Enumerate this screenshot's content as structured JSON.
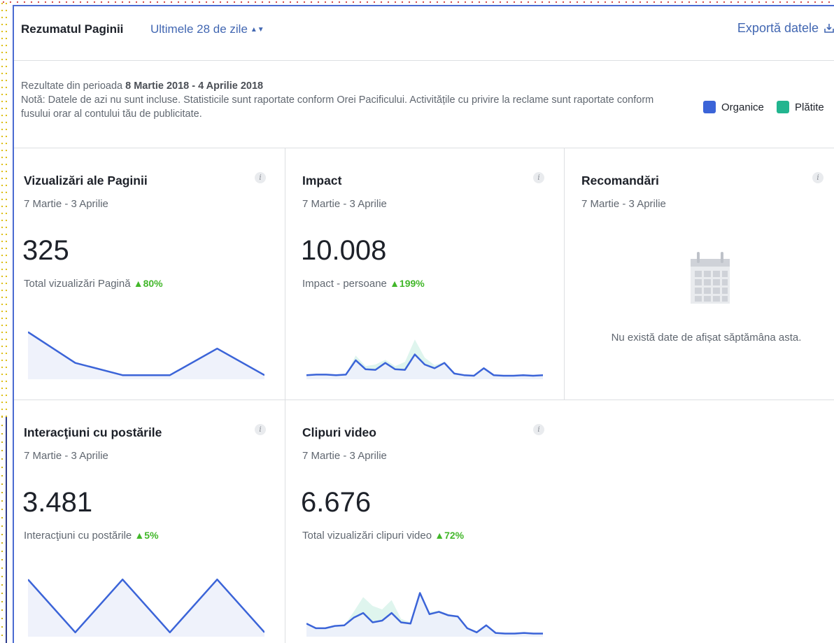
{
  "header": {
    "title": "Rezumatul Paginii",
    "range_label": "Ultimele 28 de zile",
    "export_label": "Exportă datele"
  },
  "info": {
    "period_prefix": "Rezultate din perioada",
    "period": "8 Martie 2018 - 4 Aprilie 2018",
    "note": "Notă: Datele de azi nu sunt incluse. Statisticile sunt raportate conform Orei Pacificului. Activitățile cu privire la reclame sunt raportate conform fusului orar al contului tău de publicitate."
  },
  "legend": {
    "organic_label": "Organice",
    "organic_color": "#3b64d8",
    "paid_label": "Plătite",
    "paid_color": "#22b58f"
  },
  "cards": [
    {
      "title": "Vizualizări ale Paginii",
      "date_range": "7 Martie - 3 Aprilie",
      "value": "325",
      "metric_label": "Total vizualizări Pagină",
      "delta": "▲80%",
      "series": [
        0.86,
        0.28,
        0.05,
        0.05,
        0.55,
        0.05
      ],
      "paid_series": []
    },
    {
      "title": "Impact",
      "date_range": "7 Martie - 3 Aprilie",
      "value": "10.008",
      "metric_label": "Impact - persoane",
      "delta": "▲199%",
      "series": [
        0.05,
        0.06,
        0.06,
        0.05,
        0.06,
        0.33,
        0.16,
        0.15,
        0.28,
        0.16,
        0.15,
        0.44,
        0.25,
        0.18,
        0.28,
        0.08,
        0.05,
        0.04,
        0.18,
        0.05,
        0.04,
        0.04,
        0.05,
        0.04,
        0.05
      ],
      "paid_series": [
        0.05,
        0.06,
        0.06,
        0.05,
        0.06,
        0.42,
        0.22,
        0.25,
        0.34,
        0.22,
        0.3,
        0.72,
        0.38,
        0.24,
        0.3,
        0.1,
        0.06,
        0.05,
        0.2,
        0.06,
        0.05,
        0.05,
        0.06,
        0.05,
        0.06
      ]
    },
    {
      "title": "Recomandări",
      "date_range": "7 Martie - 3 Aprilie",
      "empty_message": "Nu există date de afișat săptămâna asta."
    },
    {
      "title": "Interacţiuni cu postările",
      "date_range": "7 Martie - 3 Aprilie",
      "value": "3.481",
      "metric_label": "Interacţiuni cu postările",
      "delta": "▲5%",
      "series": [
        0.95,
        0.05,
        0.95,
        0.05,
        0.95,
        0.05
      ],
      "paid_series": []
    },
    {
      "title": "Clipuri video",
      "date_range": "7 Martie - 3 Aprilie",
      "value": "6.676",
      "metric_label": "Total vizualizări clipuri video",
      "delta": "▲72%",
      "series": [
        0.2,
        0.12,
        0.12,
        0.16,
        0.17,
        0.3,
        0.38,
        0.22,
        0.25,
        0.38,
        0.22,
        0.2,
        0.72,
        0.36,
        0.4,
        0.34,
        0.32,
        0.12,
        0.05,
        0.17,
        0.04,
        0.03,
        0.03,
        0.04,
        0.03,
        0.03
      ],
      "paid_series": [
        0.2,
        0.12,
        0.12,
        0.16,
        0.17,
        0.4,
        0.65,
        0.5,
        0.44,
        0.6,
        0.28,
        0.22,
        0.72,
        0.4,
        0.42,
        0.36,
        0.33,
        0.13,
        0.06,
        0.18,
        0.05,
        0.04,
        0.04,
        0.05,
        0.04,
        0.04
      ]
    }
  ]
}
